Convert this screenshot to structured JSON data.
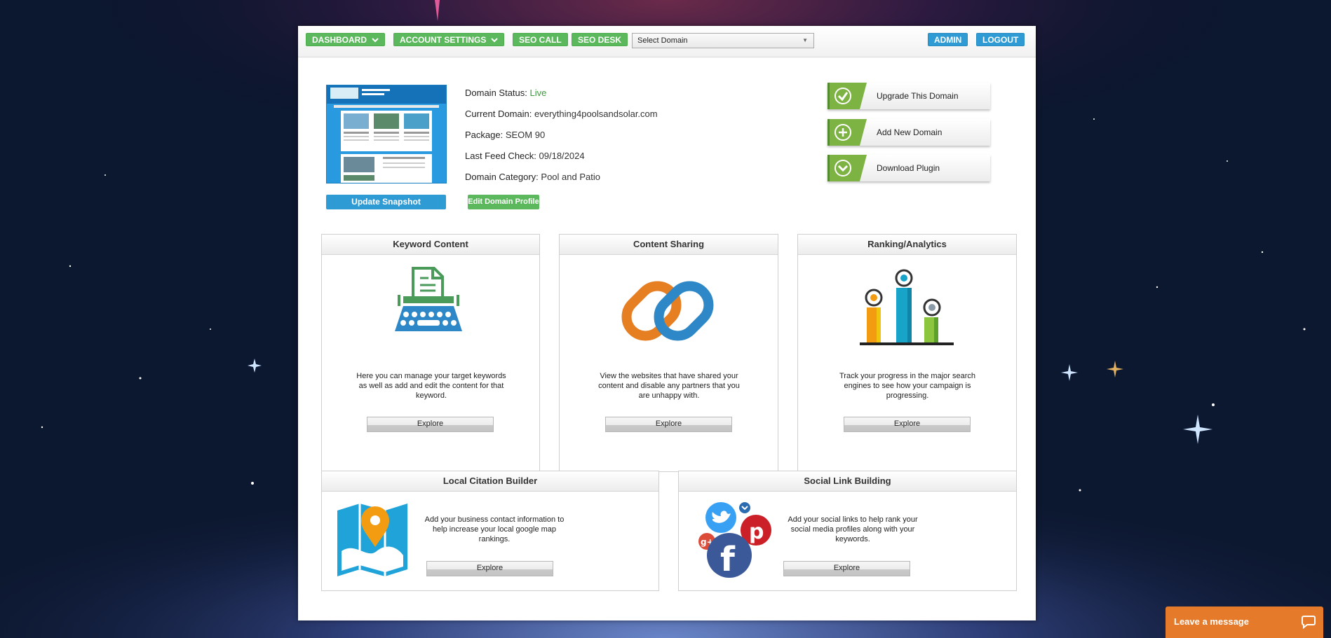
{
  "topbar": {
    "dashboard": "DASHBOARD",
    "account_settings": "ACCOUNT SETTINGS",
    "seo_call": "SEO CALL",
    "seo_desk": "SEO DESK",
    "select_domain": "Select Domain",
    "admin": "ADMIN",
    "logout": "LOGOUT"
  },
  "domain": {
    "status_label": "Domain Status:",
    "status_value": "Live",
    "current_label": "Current Domain:",
    "current_value": "everything4poolsandsolar.com",
    "package_label": "Package:",
    "package_value": "SEOM 90",
    "feed_label": "Last Feed Check:",
    "feed_value": "09/18/2024",
    "category_label": "Domain Category:",
    "category_value": "Pool and Patio",
    "update_snapshot": "Update Snapshot",
    "edit_profile": "Edit Domain Profile"
  },
  "actions": {
    "upgrade": "Upgrade This Domain",
    "add": "Add New Domain",
    "download": "Download Plugin"
  },
  "cards": {
    "keyword": {
      "title": "Keyword Content",
      "desc": "Here you can manage your target keywords as well as add and edit the content for that keyword.",
      "explore": "Explore"
    },
    "sharing": {
      "title": "Content Sharing",
      "desc": "View the websites that have shared your content and disable any partners that you are unhappy with.",
      "explore": "Explore"
    },
    "ranking": {
      "title": "Ranking/Analytics",
      "desc": "Track your progress in the major search engines to see how your campaign is progressing.",
      "explore": "Explore"
    },
    "citation": {
      "title": "Local Citation Builder",
      "desc": "Add your business contact information to help increase your local google map rankings.",
      "explore": "Explore"
    },
    "social": {
      "title": "Social Link Building",
      "desc": "Add your social links to help rank your social media profiles along with your keywords.",
      "explore": "Explore"
    }
  },
  "chat": {
    "label": "Leave a message"
  },
  "colors": {
    "green": "#5cb85c",
    "blue": "#2f9bd5",
    "chat_orange": "#e57a2a",
    "live_green": "#3c9a3c"
  }
}
